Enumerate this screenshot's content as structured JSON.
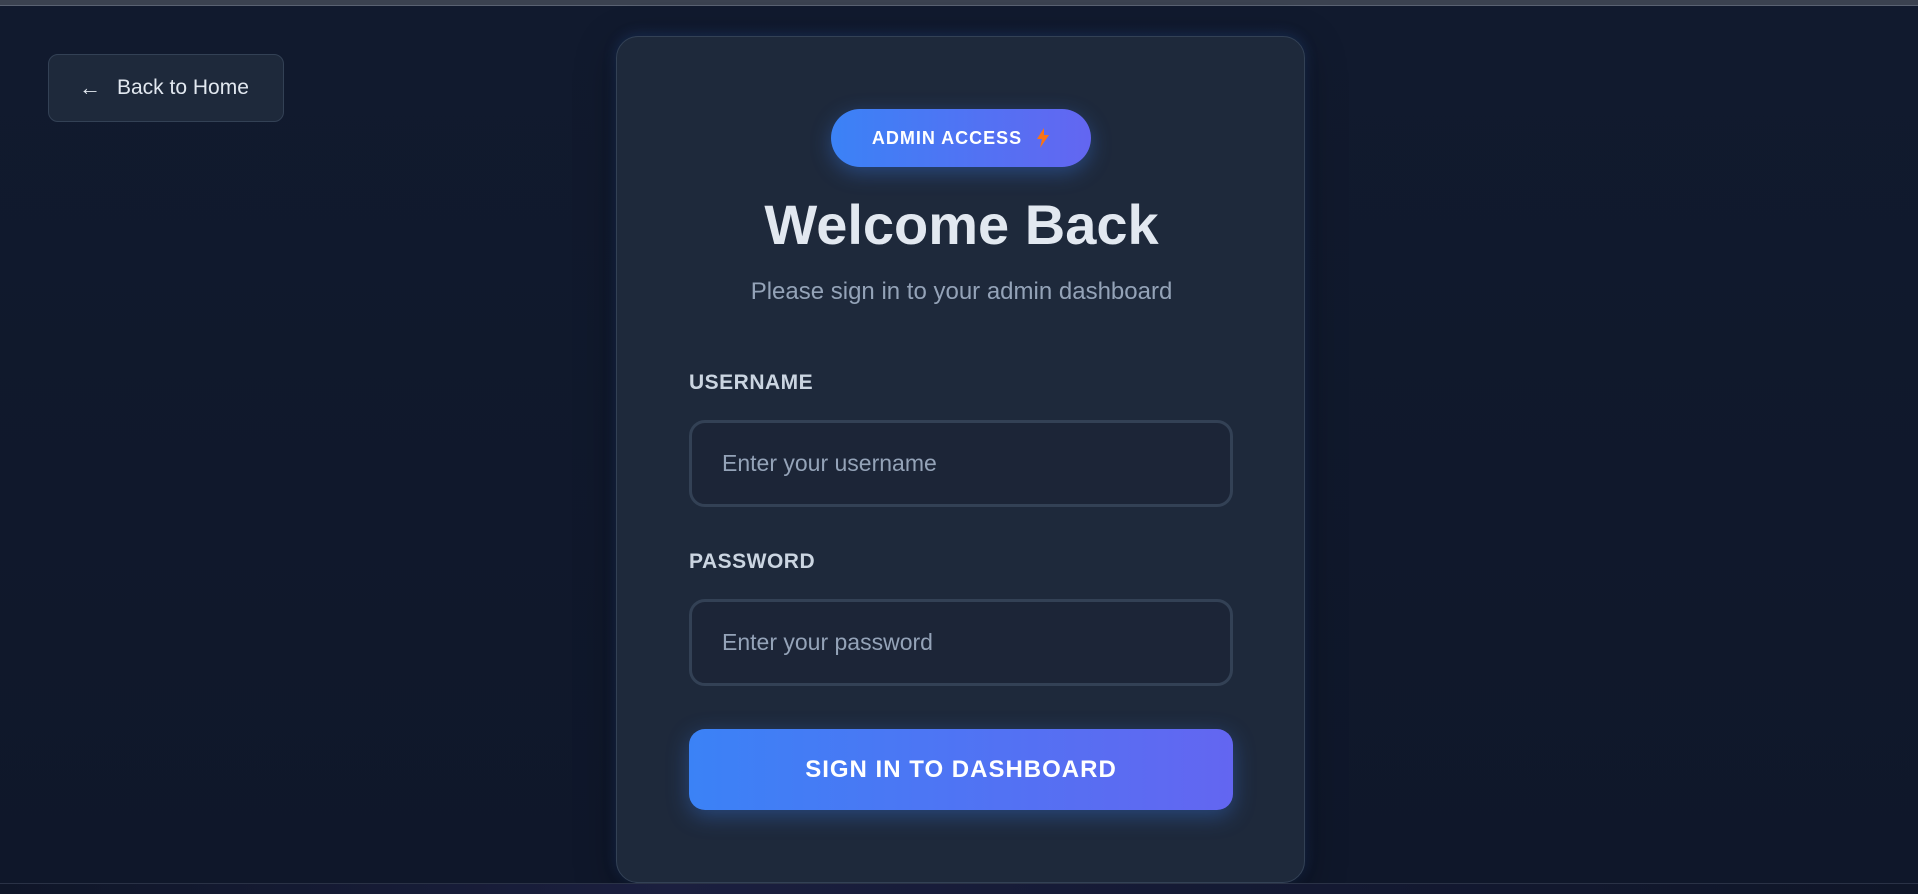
{
  "nav": {
    "back_arrow": "←",
    "back_label": "Back to Home"
  },
  "login": {
    "badge_text": "ADMIN ACCESS",
    "badge_icon": "lightning-bolt-icon",
    "title": "Welcome Back",
    "subtitle": "Please sign in to your admin dashboard",
    "username": {
      "label": "USERNAME",
      "placeholder": "Enter your username",
      "value": ""
    },
    "password": {
      "label": "PASSWORD",
      "placeholder": "Enter your password",
      "value": ""
    },
    "submit_label": "SIGN IN TO DASHBOARD"
  },
  "colors": {
    "background": "#0f172a",
    "card": "#1e293b",
    "border": "#334155",
    "accent_start": "#3b82f6",
    "accent_end": "#6366f1",
    "bolt": "#f97316"
  }
}
